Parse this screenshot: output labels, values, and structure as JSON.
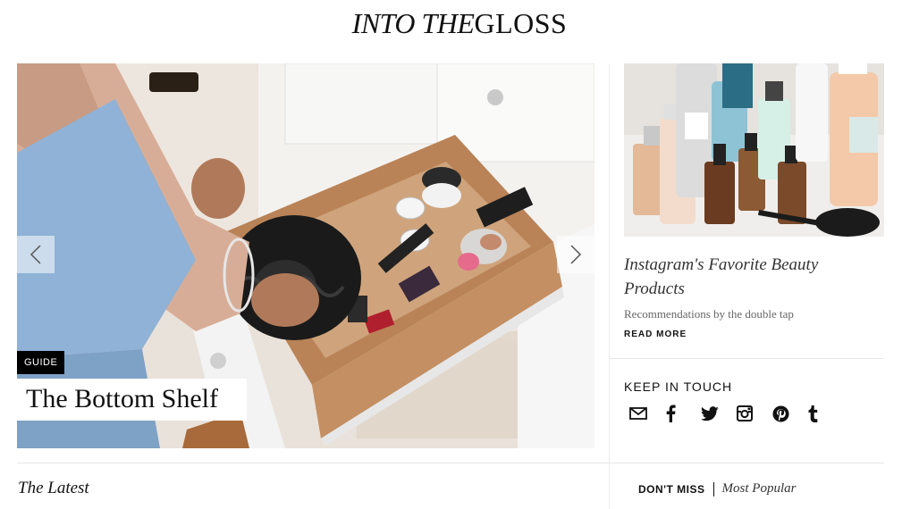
{
  "header": {
    "logo_part1": "INTO THE",
    "logo_part2": "GLOSS"
  },
  "hero": {
    "tag": "GUIDE",
    "title": "The Bottom Shelf",
    "prev_icon": "chevron-left-icon",
    "next_icon": "chevron-right-icon"
  },
  "sidebar": {
    "story_title": "Instagram's Favorite Beauty Products",
    "story_desc": "Recommendations by the double tap",
    "read_more": "READ MORE",
    "keep_in_touch": "KEEP IN TOUCH",
    "social_icons": [
      "envelope-icon",
      "facebook-icon",
      "twitter-icon",
      "instagram-icon",
      "pinterest-icon",
      "tumblr-icon"
    ]
  },
  "bottom": {
    "latest": "The Latest",
    "dont_miss": "DON'T MISS",
    "most_popular": "Most Popular"
  },
  "colors": {
    "text": "#111111",
    "tag_bg": "#000000",
    "divider": "#e6e6e6"
  }
}
